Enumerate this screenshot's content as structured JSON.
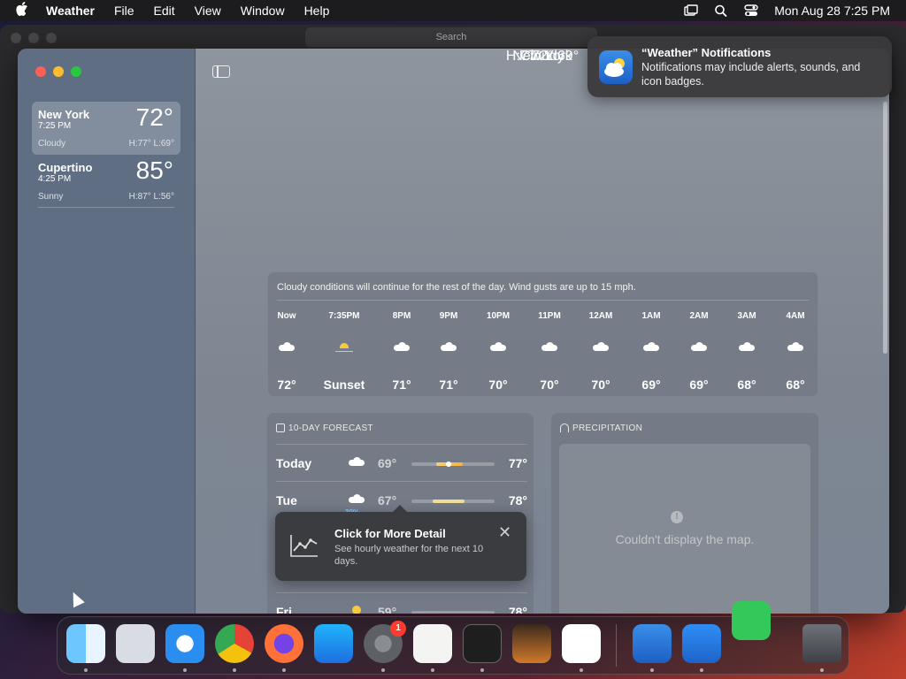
{
  "menubar": {
    "app": "Weather",
    "items": [
      "File",
      "Edit",
      "View",
      "Window",
      "Help"
    ],
    "clock": "Mon Aug 28  7:25 PM"
  },
  "bgwindow": {
    "search_placeholder": "Search"
  },
  "sidebar": {
    "cities": [
      {
        "name": "New York",
        "time": "7:25 PM",
        "temp": "72°",
        "cond": "Cloudy",
        "hl": "H:77°  L:69°"
      },
      {
        "name": "Cupertino",
        "time": "4:25 PM",
        "temp": "85°",
        "cond": "Sunny",
        "hl": "H:87°  L:56°"
      }
    ]
  },
  "hero": {
    "city": "New York",
    "temp": "72°",
    "cond": "Cloudy",
    "hl": "H:77°  L:69°"
  },
  "hourly": {
    "summary": "Cloudy conditions will continue for the rest of the day. Wind gusts are up to 15 mph.",
    "hours": [
      {
        "h": "Now",
        "icon": "cloud",
        "t": "72°"
      },
      {
        "h": "7:35PM",
        "icon": "sunset",
        "t": "Sunset"
      },
      {
        "h": "8PM",
        "icon": "cloud",
        "t": "71°"
      },
      {
        "h": "9PM",
        "icon": "cloud",
        "t": "71°"
      },
      {
        "h": "10PM",
        "icon": "cloud",
        "t": "70°"
      },
      {
        "h": "11PM",
        "icon": "cloud",
        "t": "70°"
      },
      {
        "h": "12AM",
        "icon": "cloud",
        "t": "70°"
      },
      {
        "h": "1AM",
        "icon": "cloud",
        "t": "69°"
      },
      {
        "h": "2AM",
        "icon": "cloud",
        "t": "69°"
      },
      {
        "h": "3AM",
        "icon": "cloud",
        "t": "68°"
      },
      {
        "h": "4AM",
        "icon": "cloud",
        "t": "68°"
      }
    ]
  },
  "forecast": {
    "title": "10-DAY FORECAST",
    "days": [
      {
        "day": "Today",
        "icon": "cloud",
        "lo": "69°",
        "hi": "77°",
        "pct": ""
      },
      {
        "day": "Tue",
        "icon": "rain",
        "lo": "67°",
        "hi": "78°",
        "pct": "30%"
      }
    ],
    "partial": [
      {
        "day": "Fri",
        "lo": "59°",
        "hi": "78°"
      }
    ]
  },
  "precip": {
    "title": "PRECIPITATION",
    "message": "Couldn't display the map."
  },
  "tip": {
    "title": "Click for More Detail",
    "body": "See hourly weather for the next 10 days."
  },
  "notification": {
    "title": "“Weather” Notifications",
    "body": "Notifications may include alerts, sounds, and icon badges."
  },
  "dock": {
    "apps": [
      "finder-icon",
      "launchpad-icon",
      "safari-icon",
      "chrome-icon",
      "firefox-icon",
      "app-store-icon",
      "system-settings-icon",
      "textedit-icon",
      "terminal-icon",
      "garageband-icon",
      "vscode-icon",
      "weather-icon",
      "keynote-icon",
      "messages-icon",
      "trash-icon"
    ],
    "settings_badge": "1"
  },
  "colors": {
    "accent_blue": "#1d6fe0",
    "badge_red": "#ff3b30",
    "temp_bar": "#f3b43c"
  }
}
